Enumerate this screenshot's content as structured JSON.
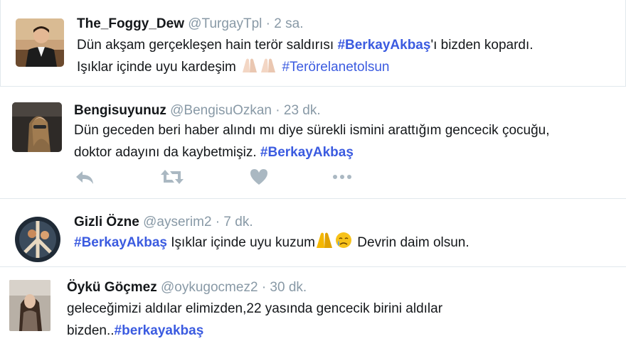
{
  "tweets": [
    {
      "name": "The_Foggy_Dew",
      "handle": "@TurgayTpl",
      "separator": "·",
      "time": "2 sa.",
      "line1_text": "Dün akşam gerçekleşen hain terör saldırısı ",
      "line1_hashtag": "#BerkayAkbaş",
      "line1_suffix": "'ı bizden kopardı.",
      "line2_text": "Işıklar içinde uyu kardeşim ",
      "line2_emoji": "praying-hands-emoji",
      "line2_hashtag": "#Terörelanetolsun"
    },
    {
      "name": "Bengisuyunuz",
      "handle": "@BengisuOzkan",
      "separator": "·",
      "time": "23 dk.",
      "line1_text": "Dün geceden beri haber alındı mı diye sürekli ismini arattığım gencecik çocuğu,",
      "line2_text": "doktor adayını da kaybetmişiz. ",
      "line2_hashtag": "#BerkayAkbaş",
      "actions": [
        "reply-icon",
        "retweet-icon",
        "like-icon",
        "more-icon"
      ]
    },
    {
      "name": "Gizli Özne",
      "handle": "@ayserim2",
      "separator": "·",
      "time": "7 dk.",
      "line1_hashtag": "#BerkayAkbaş",
      "line1_text": " Işıklar içinde uyu kuzum",
      "line1_emoji": "praying-crying-emoji",
      "line1_suffix": " Devrin daim olsun."
    },
    {
      "name": "Öykü Göçmez",
      "handle": "@oykugocmez2",
      "separator": "·",
      "time": "30 dk.",
      "line1_text": "geleceğimizi aldılar elimizden,22 yasında gencecik birini aldılar",
      "line2_text": "bizden..",
      "line2_hashtag": "#berkayakbaş"
    }
  ],
  "colors": {
    "hashtag": "#3b5be0",
    "muted": "#8899a6",
    "text": "#14171a",
    "divider": "#e1e8ed",
    "action_icon": "#aab8c2"
  }
}
